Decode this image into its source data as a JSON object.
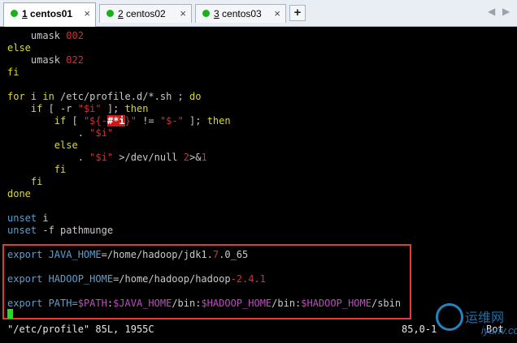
{
  "tabs": [
    {
      "num": "1",
      "label": "centos01",
      "active": true,
      "close": "×"
    },
    {
      "num": "2",
      "label": "centos02",
      "active": false,
      "close": "×"
    },
    {
      "num": "3",
      "label": "centos03",
      "active": false,
      "close": "×"
    }
  ],
  "add_tab": "+",
  "nav": {
    "left": "◀",
    "right": "▶"
  },
  "code": {
    "l1": [
      "    umask ",
      "002"
    ],
    "l2": "else",
    "l3": [
      "    umask ",
      "022"
    ],
    "l4": "fi",
    "l5": [
      "for",
      " i ",
      "in",
      " /etc/profile.d/*.sh ; ",
      "do"
    ],
    "l6": [
      "    ",
      "if",
      " [ -r ",
      "\"$i\"",
      " ]; ",
      "then"
    ],
    "l7": [
      "        ",
      "if",
      " [ ",
      "\"${-",
      "#*i",
      "}\"",
      " != ",
      "\"$-\"",
      " ]; ",
      "then"
    ],
    "l8": [
      "            . ",
      "\"$i\""
    ],
    "l9": [
      "        ",
      "else"
    ],
    "l10": [
      "            . ",
      "\"$i\"",
      " >/dev/null ",
      "2",
      ">&",
      "1"
    ],
    "l11": [
      "        ",
      "fi"
    ],
    "l12": [
      "    ",
      "fi"
    ],
    "l13": "done",
    "l14": [
      "unset",
      " i"
    ],
    "l15": [
      "unset",
      " -f pathmunge"
    ],
    "l16": [
      "export",
      " JAVA_HOME",
      "=/home/hadoop/jdk1.",
      "7",
      ".0_65"
    ],
    "l17": [
      "export",
      " HADOOP_HOME",
      "=/home/hadoop/hadoop",
      "-2.4.1"
    ],
    "l18": [
      "export",
      " PATH=",
      "$PATH",
      ":",
      "$JAVA_HOME",
      "/bin:",
      "$HADOOP_HOME",
      "/bin:",
      "$HADOOP_HOME",
      "/sbin"
    ]
  },
  "status": {
    "file": "\"/etc/profile\" 85L, 1955C",
    "position": "85,0-1",
    "scroll": "Bot"
  },
  "watermark": {
    "cn": "运维网",
    "url": "iyunv.com"
  }
}
